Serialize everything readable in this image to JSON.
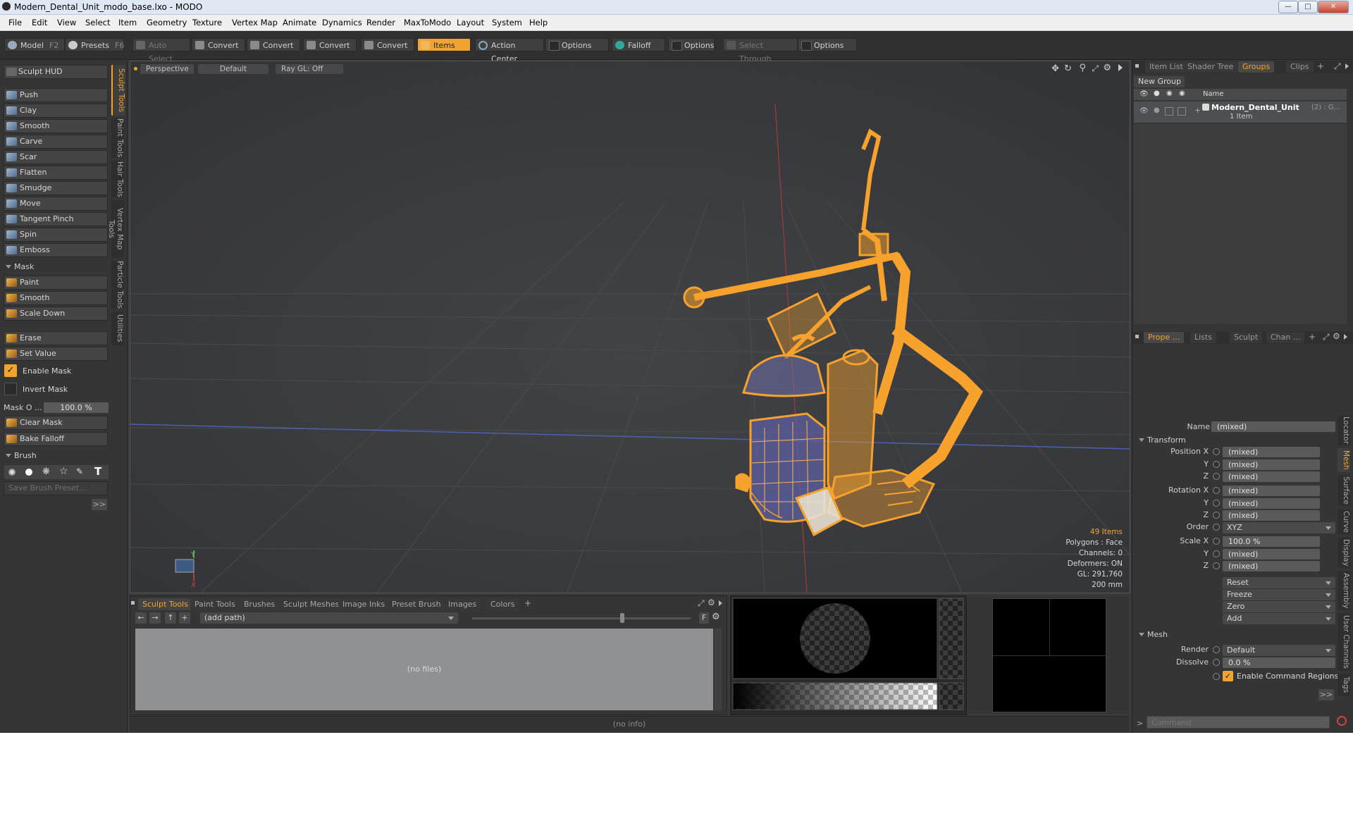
{
  "window": {
    "title": "Modern_Dental_Unit_modo_base.lxo - MODO"
  },
  "menu": [
    "File",
    "Edit",
    "View",
    "Select",
    "Item",
    "Geometry",
    "Texture",
    "Vertex Map",
    "Animate",
    "Dynamics",
    "Render",
    "MaxToModo",
    "Layout",
    "System",
    "Help"
  ],
  "toolbar": {
    "model": "Model",
    "model_key": "F2",
    "presets": "Presets",
    "presets_key": "F6",
    "auto_select": "Auto Select",
    "convert1": "Convert",
    "convert2": "Convert",
    "convert3": "Convert",
    "convert4": "Convert",
    "items": "Items",
    "action_center": "Action Center",
    "options1": "Options",
    "falloff": "Falloff",
    "options2": "Options",
    "select_through": "Select Through",
    "options3": "Options"
  },
  "left": {
    "sculpt_hud": "Sculpt HUD",
    "tools": [
      "Push",
      "Clay",
      "Smooth",
      "Carve",
      "Scar",
      "Flatten",
      "Smudge",
      "Move",
      "Tangent Pinch",
      "Spin",
      "Emboss"
    ],
    "mask_header": "Mask",
    "mask_tools": [
      "Paint",
      "Smooth",
      "Scale Down"
    ],
    "erase": "Erase",
    "set_value": "Set Value",
    "enable_mask": "Enable Mask",
    "invert_mask": "Invert Mask",
    "mask_opacity_label": "Mask O ...",
    "mask_opacity_value": "100.0 %",
    "clear_mask": "Clear Mask",
    "bake_falloff": "Bake Falloff",
    "brush_header": "Brush",
    "save_brush_preset": "Save Brush Preset...",
    "more": ">>",
    "vtabs": [
      "Sculpt Tools",
      "Paint Tools",
      "Hair Tools",
      "Vertex Map Tools",
      "Particle Tools",
      "Utilities"
    ]
  },
  "viewport": {
    "perspective": "Perspective",
    "default": "Default",
    "raygl": "Ray GL: Off",
    "stats": {
      "items": "49 Items",
      "polygons": "Polygons : Face",
      "channels": "Channels: 0",
      "deformers": "Deformers: ON",
      "gl": "GL: 291,760",
      "scale": "200 mm"
    },
    "axis_y": "Y",
    "axis_x": "X"
  },
  "browser": {
    "tabs": [
      "Sculpt Tools",
      "Paint Tools",
      "Brushes",
      "Sculpt Meshes",
      "Image Inks",
      "Preset Brush",
      "Images",
      "Colors"
    ],
    "add": "+",
    "path": "(add path)",
    "empty": "(no files)",
    "f_button": "F",
    "info": "(no info)"
  },
  "groups": {
    "tabs": [
      "Item List",
      "Shader Tree",
      "Groups",
      "Clips"
    ],
    "add": "+",
    "new_group": "New Group",
    "col_name": "Name",
    "row_name": "Modern_Dental_Unit",
    "row_count": "(2) : G...",
    "row_sub": "1 Item"
  },
  "properties": {
    "tabs": [
      "Prope ...",
      "Lists",
      "Sculpt",
      "Chan ..."
    ],
    "add": "+",
    "name_label": "Name",
    "name_value": "(mixed)",
    "transform_header": "Transform",
    "position_label": "Position X",
    "y_label": "Y",
    "z_label": "Z",
    "rotation_label": "Rotation X",
    "order_label": "Order",
    "order_value": "XYZ",
    "scale_label": "Scale X",
    "mixed": "(mixed)",
    "scale_x_value": "100.0 %",
    "reset": "Reset",
    "freeze": "Freeze",
    "zero": "Zero",
    "add_btn": "Add",
    "mesh_header": "Mesh",
    "render_label": "Render",
    "render_value": "Default",
    "dissolve_label": "Dissolve",
    "dissolve_value": "0.0 %",
    "enable_cmd_regions": "Enable Command Regions",
    "more": ">>",
    "vtabs": [
      "Locator",
      "Mesh",
      "Surface",
      "Curve",
      "Display",
      "Assembly",
      "User Channels",
      "Tags"
    ]
  },
  "command": {
    "prompt": ">",
    "placeholder": "Command"
  },
  "colors": {
    "accent": "#f0a431",
    "mesh": "#f7a22c",
    "viewport_bg": "#3b3c3f"
  }
}
